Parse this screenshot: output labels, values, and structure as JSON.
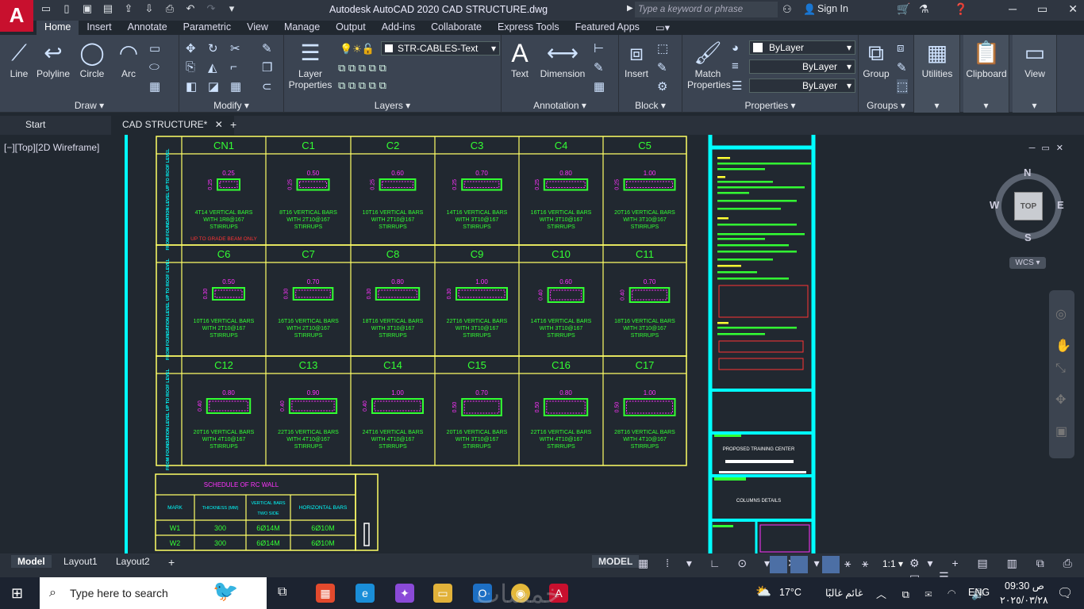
{
  "app": {
    "title": "Autodesk AutoCAD 2020    CAD STRUCTURE.dwg",
    "logo": "A"
  },
  "search": {
    "placeholder": "Type a keyword or phrase"
  },
  "account": {
    "signin": "Sign In"
  },
  "ribbon_tabs": [
    "Home",
    "Insert",
    "Annotate",
    "Parametric",
    "View",
    "Manage",
    "Output",
    "Add-ins",
    "Collaborate",
    "Express Tools",
    "Featured Apps"
  ],
  "ribbon": {
    "draw": {
      "title": "Draw",
      "line": "Line",
      "polyline": "Polyline",
      "circle": "Circle",
      "arc": "Arc"
    },
    "modify": {
      "title": "Modify"
    },
    "layers": {
      "title": "Layers",
      "layer_properties": "Layer Properties",
      "current_layer": "STR-CABLES-Text"
    },
    "annotation": {
      "title": "Annotation",
      "text": "Text",
      "dimension": "Dimension"
    },
    "block": {
      "title": "Block",
      "insert": "Insert"
    },
    "properties": {
      "title": "Properties",
      "match": "Match Properties",
      "color": "ByLayer",
      "linetype": "ByLayer",
      "lineweight": "ByLayer"
    },
    "groups": {
      "title": "Groups",
      "group": "Group"
    },
    "utilities": "Utilities",
    "clipboard": "Clipboard",
    "view": "View"
  },
  "doc_tabs": {
    "start": "Start",
    "active": "CAD STRUCTURE*"
  },
  "viewport": {
    "label": "[−][Top][2D Wireframe]"
  },
  "viewcube": {
    "n": "N",
    "s": "S",
    "e": "E",
    "w": "W",
    "top": "TOP",
    "wcs": "WCS"
  },
  "drawing": {
    "side_labels": [
      "FROM FOUNDATION LEVEL UP TO ROOF LEVEL",
      "FROM FOUNDATION LEVEL UP TO ROOF LEVEL",
      "FROM FOUNDATION LEVEL UP TO ROOF LEVEL"
    ],
    "rows": [
      [
        {
          "mark": "CN1",
          "w": "0.25",
          "d": "0.25",
          "bars": "4T14 VERTICAL BARS",
          "ties": "WITH 1R8@167",
          "st": "STIRRUPS",
          "note": "UP TO GRADE BEAM ONLY"
        },
        {
          "mark": "C1",
          "w": "0.50",
          "d": "0.25",
          "bars": "8T16 VERTICAL BARS",
          "ties": "WITH 2T10@167",
          "st": "STIRRUPS"
        },
        {
          "mark": "C2",
          "w": "0.60",
          "d": "0.25",
          "bars": "10T16 VERTICAL BARS",
          "ties": "WITH 2T10@167",
          "st": "STIRRUPS"
        },
        {
          "mark": "C3",
          "w": "0.70",
          "d": "0.25",
          "bars": "14T16 VERTICAL BARS",
          "ties": "WITH 3T10@167",
          "st": "STIRRUPS"
        },
        {
          "mark": "C4",
          "w": "0.80",
          "d": "0.25",
          "bars": "16T16 VERTICAL BARS",
          "ties": "WITH 3T10@167",
          "st": "STIRRUPS"
        },
        {
          "mark": "C5",
          "w": "1.00",
          "d": "0.25",
          "bars": "20T16 VERTICAL BARS",
          "ties": "WITH 3T10@167",
          "st": "STIRRUPS"
        }
      ],
      [
        {
          "mark": "C6",
          "w": "0.50",
          "d": "0.30",
          "bars": "10T16 VERTICAL BARS",
          "ties": "WITH 2T10@167",
          "st": "STIRRUPS"
        },
        {
          "mark": "C7",
          "w": "0.70",
          "d": "0.30",
          "bars": "16T16 VERTICAL BARS",
          "ties": "WITH 2T10@167",
          "st": "STIRRUPS"
        },
        {
          "mark": "C8",
          "w": "0.80",
          "d": "0.30",
          "bars": "18T16 VERTICAL BARS",
          "ties": "WITH 3T10@167",
          "st": "STIRRUPS"
        },
        {
          "mark": "C9",
          "w": "1.00",
          "d": "0.30",
          "bars": "22T16 VERTICAL BARS",
          "ties": "WITH 3T10@167",
          "st": "STIRRUPS"
        },
        {
          "mark": "C10",
          "w": "0.60",
          "d": "0.40",
          "bars": "14T16 VERTICAL BARS",
          "ties": "WITH 3T10@167",
          "st": "STIRRUPS"
        },
        {
          "mark": "C11",
          "w": "0.70",
          "d": "0.40",
          "bars": "18T16 VERTICAL BARS",
          "ties": "WITH 3T10@167",
          "st": "STIRRUPS"
        }
      ],
      [
        {
          "mark": "C12",
          "w": "0.80",
          "d": "0.40",
          "bars": "20T16 VERTICAL BARS",
          "ties": "WITH 4T10@167",
          "st": "STIRRUPS"
        },
        {
          "mark": "C13",
          "w": "0.90",
          "d": "0.40",
          "bars": "22T16 VERTICAL BARS",
          "ties": "WITH 4T10@167",
          "st": "STIRRUPS"
        },
        {
          "mark": "C14",
          "w": "1.00",
          "d": "0.40",
          "bars": "24T16 VERTICAL BARS",
          "ties": "WITH 4T10@167",
          "st": "STIRRUPS"
        },
        {
          "mark": "C15",
          "w": "0.70",
          "d": "0.50",
          "bars": "20T16 VERTICAL BARS",
          "ties": "WITH 3T10@167",
          "st": "STIRRUPS"
        },
        {
          "mark": "C16",
          "w": "0.80",
          "d": "0.50",
          "bars": "22T16 VERTICAL BARS",
          "ties": "WITH 4T10@167",
          "st": "STIRRUPS"
        },
        {
          "mark": "C17",
          "w": "1.00",
          "d": "0.50",
          "bars": "28T16 VERTICAL BARS",
          "ties": "WITH 4T10@167",
          "st": "STIRRUPS"
        }
      ]
    ],
    "wall_schedule": {
      "title": "SCHEDULE OF RC WALL",
      "headers": [
        "MARK",
        "THICKNESS (MM)",
        "VERTICAL BARS TWO SIDE",
        "HORIZONTAL BARS"
      ],
      "rows": [
        [
          "W1",
          "300",
          "6Ø14M",
          "6Ø10M"
        ],
        [
          "W2",
          "300",
          "6Ø14M",
          "6Ø10M"
        ]
      ]
    },
    "title_block": {
      "project": "PROPOSED TRAINING CENTER",
      "sheet": "COLUMNS DETAILS"
    }
  },
  "model_tabs": [
    "Model",
    "Layout1",
    "Layout2"
  ],
  "status": {
    "model": "MODEL",
    "scale": "1:1"
  },
  "taskbar": {
    "search": "Type here to search",
    "weather": "17°C",
    "weather_desc": "غائم غالبًا",
    "lang": "ENG",
    "time": "09:30 ص",
    "date": "٢٠٢٥/٠٣/٢٨",
    "watermark": "خمسات"
  },
  "colors": {
    "frame": "#ffff66",
    "cyan": "#00ffff",
    "green": "#33ff33",
    "magenta": "#ff33ff",
    "red": "#ff3333",
    "bg": "#212830"
  }
}
